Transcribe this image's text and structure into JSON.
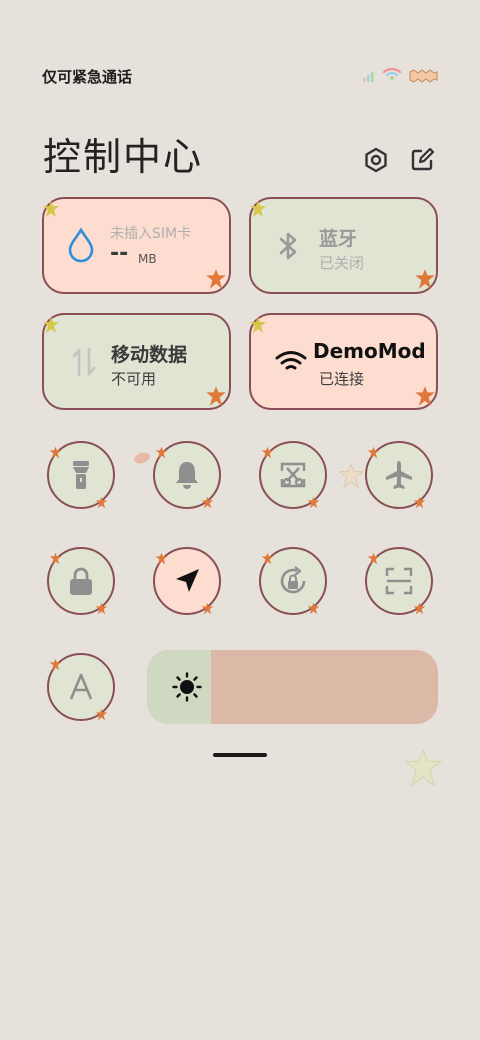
{
  "status": {
    "carrier_text": "仅可紧急通话"
  },
  "header": {
    "title": "控制中心"
  },
  "tiles": {
    "sim": {
      "title": "未插入SIM卡",
      "value": "--",
      "unit": "MB"
    },
    "bluetooth": {
      "title": "蓝牙",
      "status": "已关闭"
    },
    "mobile_data": {
      "title": "移动数据",
      "status": "不可用"
    },
    "wifi": {
      "title": "DemoMod",
      "status": "已连接"
    }
  },
  "toggles": [
    {
      "name": "flashlight",
      "icon": "flashlight-icon",
      "active": false
    },
    {
      "name": "silent",
      "icon": "bell-icon",
      "active": false
    },
    {
      "name": "screenshot",
      "icon": "screenshot-icon",
      "active": false
    },
    {
      "name": "airplane",
      "icon": "airplane-icon",
      "active": false
    },
    {
      "name": "lock-screen",
      "icon": "lock-icon",
      "active": false
    },
    {
      "name": "location",
      "icon": "location-arrow-icon",
      "active": true
    },
    {
      "name": "rotation-lock",
      "icon": "rotation-lock-icon",
      "active": false
    },
    {
      "name": "scanner",
      "icon": "scan-icon",
      "active": false
    },
    {
      "name": "auto-brightness",
      "icon": "font-a-icon",
      "active": false
    }
  ],
  "brightness": {
    "level": 0.22
  },
  "colors": {
    "peach": "#fdddd0",
    "sage": "#dfe4d3",
    "border": "#8a4f55",
    "background": "#e6e1da"
  }
}
